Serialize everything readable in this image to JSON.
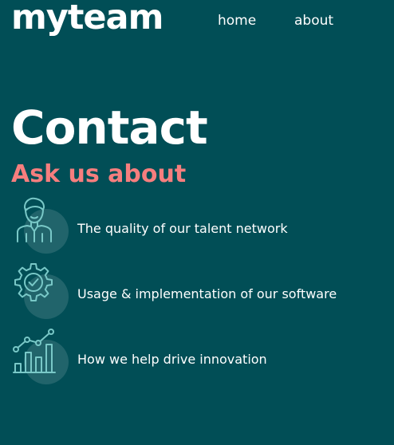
{
  "header": {
    "logo": "myteam",
    "nav": [
      {
        "label": "home"
      },
      {
        "label": "about"
      }
    ]
  },
  "main": {
    "title": "Contact",
    "subtitle": "Ask us about",
    "items": [
      {
        "label": "The quality of our talent network",
        "icon": "person-icon"
      },
      {
        "label": "Usage & implementation of our software",
        "icon": "gear-check-icon"
      },
      {
        "label": "How we help drive innovation",
        "icon": "chart-icon"
      }
    ]
  },
  "colors": {
    "background": "#014e56",
    "accent": "#f67e7e",
    "icon_stroke": "#79c8c7",
    "text": "#ffffff"
  }
}
